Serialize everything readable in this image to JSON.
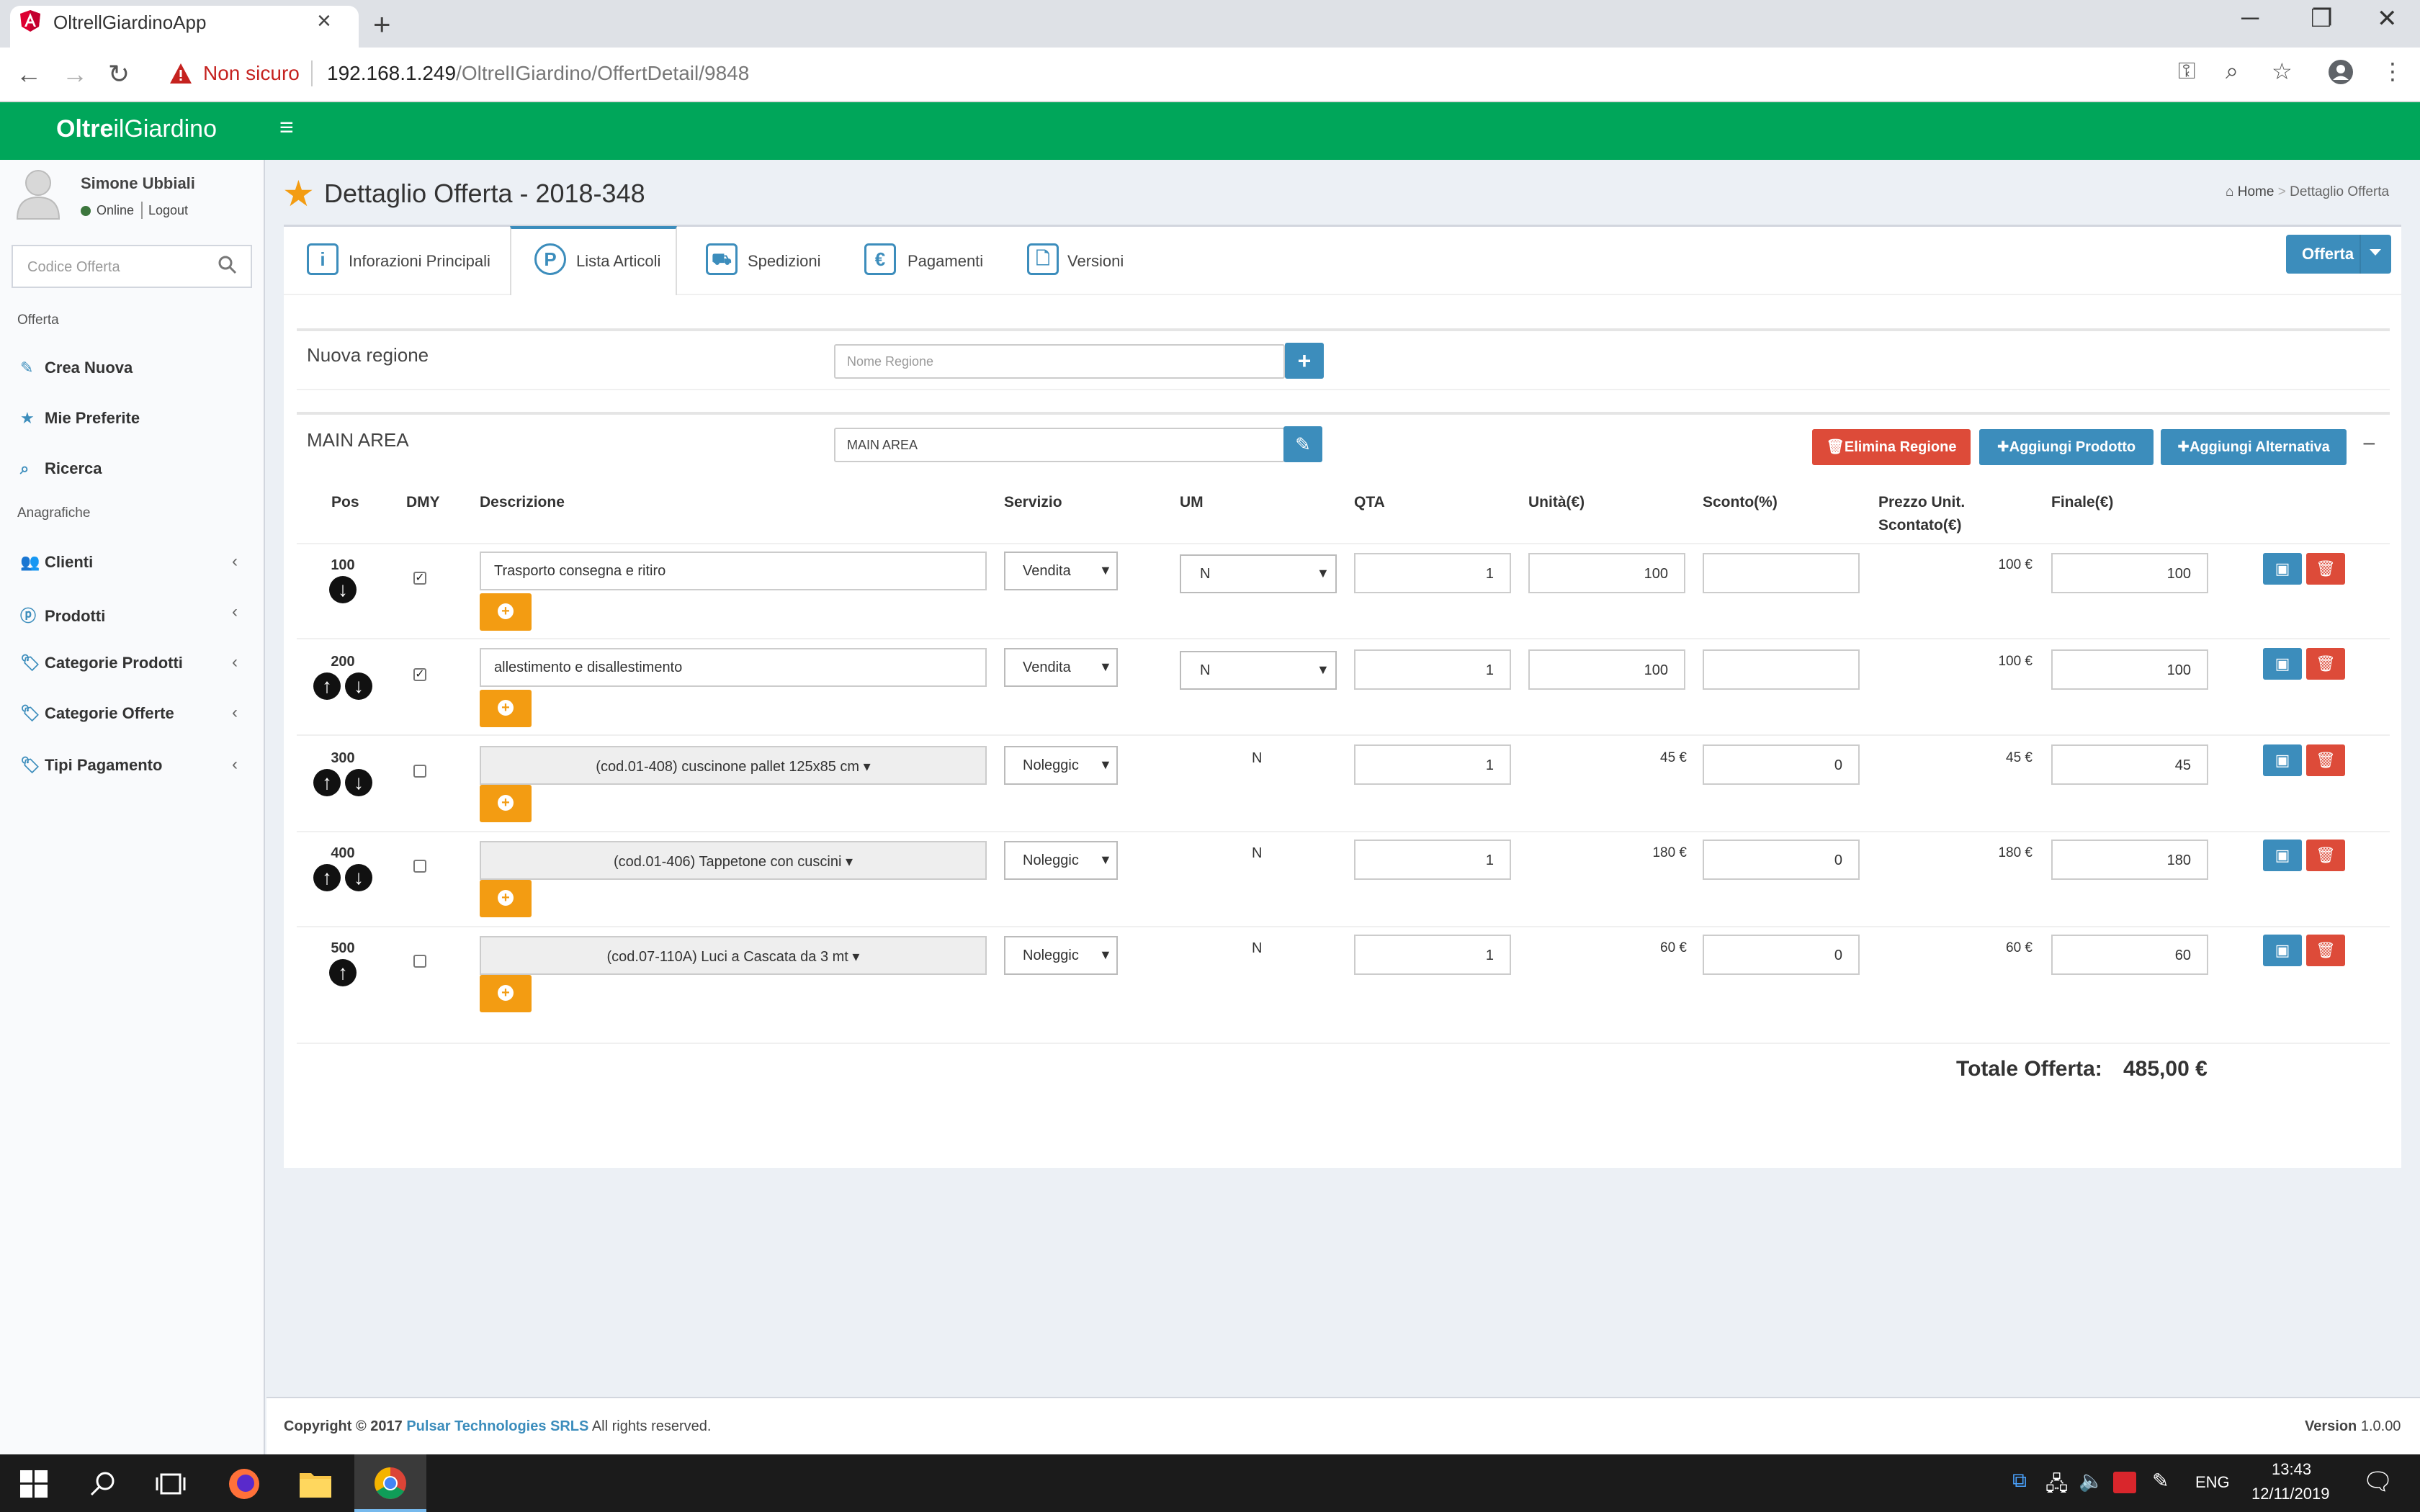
{
  "browser": {
    "tab_title": "OltrellGiardinoApp",
    "tab_close": "×",
    "new_tab": "+",
    "not_secure": "Non sicuro",
    "url_host": "192.168.1.249",
    "url_path": "/OltrelIGiardino/OffertDetail/9848"
  },
  "app": {
    "logo_bold": "Oltre",
    "logo_rest": "ilGiardino"
  },
  "user": {
    "name": "Simone Ubbiali",
    "status": "Online",
    "logout": "Logout"
  },
  "sidebar": {
    "search_placeholder": "Codice Offerta",
    "section_offerta": "Offerta",
    "section_anagrafiche": "Anagrafiche",
    "items": [
      {
        "label": "Crea Nuova",
        "icon": "pencil-icon"
      },
      {
        "label": "Mie Preferite",
        "icon": "star-icon"
      },
      {
        "label": "Ricerca",
        "icon": "search-icon"
      },
      {
        "label": "Clienti",
        "icon": "users-icon"
      },
      {
        "label": "Prodotti",
        "icon": "product-icon"
      },
      {
        "label": "Categorie Prodotti",
        "icon": "tags-icon"
      },
      {
        "label": "Categorie Offerte",
        "icon": "tags-icon"
      },
      {
        "label": "Tipi Pagamento",
        "icon": "tags-icon"
      }
    ]
  },
  "page": {
    "title": "Dettaglio Offerta - 2018-348",
    "breadcrumb_home": "Home",
    "breadcrumb_sep": ">",
    "breadcrumb_current": "Dettaglio Offerta"
  },
  "tabs": [
    {
      "label": "Inforazioni Principali",
      "icon": "info-icon"
    },
    {
      "label": "Lista Articoli",
      "icon": "product-icon"
    },
    {
      "label": "Spedizioni",
      "icon": "truck-icon"
    },
    {
      "label": "Pagamenti",
      "icon": "euro-icon"
    },
    {
      "label": "Versioni",
      "icon": "file-icon"
    }
  ],
  "offerta_button": "Offerta",
  "new_region": {
    "label": "Nuova regione",
    "placeholder": "Nome Regione"
  },
  "region": {
    "label": "MAIN AREA",
    "value": "MAIN AREA",
    "delete_button": "Elimina Regione",
    "add_product_button": "Aggiungi Prodotto",
    "add_alternative_button": "Aggiungi Alternativa",
    "collapse": "−"
  },
  "table": {
    "headers": {
      "pos": "Pos",
      "dmy": "DMY",
      "descrizione": "Descrizione",
      "servizio": "Servizio",
      "um": "UM",
      "qta": "QTA",
      "unita": "Unità(€)",
      "sconto": "Sconto(%)",
      "prezzo_line1": "Prezzo Unit.",
      "prezzo_line2": "Scontato(€)",
      "finale": "Finale(€)"
    },
    "rows": [
      {
        "pos": "100",
        "dmy": true,
        "descrizione": "Trasporto consegna e ritiro",
        "desc_editable": true,
        "servizio": "Vendita",
        "um": "N",
        "um_select": true,
        "qta": "1",
        "unita": "100",
        "unita_editable": true,
        "sconto": "",
        "prezzo": "100 €",
        "finale": "100",
        "up": false,
        "down": true
      },
      {
        "pos": "200",
        "dmy": true,
        "descrizione": "allestimento e disallestimento",
        "desc_editable": true,
        "servizio": "Vendita",
        "um": "N",
        "um_select": true,
        "qta": "1",
        "unita": "100",
        "unita_editable": true,
        "sconto": "",
        "prezzo": "100 €",
        "finale": "100",
        "up": true,
        "down": true
      },
      {
        "pos": "300",
        "dmy": false,
        "descrizione": "(cod.01-408) cuscinone pallet 125x85 cm",
        "desc_editable": false,
        "servizio": "Noleggic",
        "um": "N",
        "um_select": false,
        "qta": "1",
        "unita": "45 €",
        "unita_editable": false,
        "sconto": "0",
        "prezzo": "45 €",
        "finale": "45",
        "up": true,
        "down": true
      },
      {
        "pos": "400",
        "dmy": false,
        "descrizione": "(cod.01-406) Tappetone con cuscini",
        "desc_editable": false,
        "servizio": "Noleggic",
        "um": "N",
        "um_select": false,
        "qta": "1",
        "unita": "180 €",
        "unita_editable": false,
        "sconto": "0",
        "prezzo": "180 €",
        "finale": "180",
        "up": true,
        "down": true
      },
      {
        "pos": "500",
        "dmy": false,
        "descrizione": "(cod.07-110A) Luci a Cascata da 3 mt",
        "desc_editable": false,
        "servizio": "Noleggic",
        "um": "N",
        "um_select": false,
        "qta": "1",
        "unita": "60 €",
        "unita_editable": false,
        "sconto": "0",
        "prezzo": "60 €",
        "finale": "60",
        "up": true,
        "down": false
      }
    ]
  },
  "total": {
    "label": "Totale Offerta:",
    "value": "485,00 €"
  },
  "footer": {
    "copyright_prefix": "Copyright © 2017",
    "company": "Pulsar Technologies SRLS",
    "rights": "All rights reserved.",
    "version_label": "Version",
    "version_value": "1.0.00"
  },
  "taskbar": {
    "lang": "ENG",
    "time": "13:43",
    "date": "12/11/2019"
  },
  "colors": {
    "header_green": "#00a65a",
    "primary_blue": "#3c8dbc",
    "danger_red": "#dd4b39",
    "warning_orange": "#f39c12"
  }
}
